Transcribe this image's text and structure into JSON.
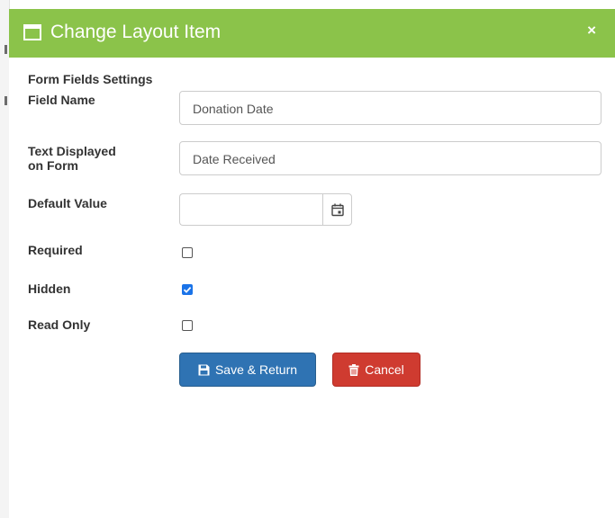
{
  "dialog": {
    "title": "Change Layout Item",
    "close_symbol": "×",
    "title_icon": "window-icon"
  },
  "form": {
    "section_title": "Form Fields Settings",
    "field_name": {
      "label": "Field Name",
      "value": "Donation Date"
    },
    "text_displayed": {
      "label_line1": "Text Displayed",
      "label_line2": "on Form",
      "value": "Date Received"
    },
    "default_value": {
      "label": "Default Value",
      "value": "",
      "icon": "calendar-icon"
    },
    "required": {
      "label": "Required",
      "checked": false
    },
    "hidden": {
      "label": "Hidden",
      "checked": true
    },
    "read_only": {
      "label": "Read Only",
      "checked": false
    }
  },
  "buttons": {
    "save_label": "Save & Return",
    "save_icon": "floppy-disk-icon",
    "cancel_label": "Cancel",
    "cancel_icon": "trash-icon"
  },
  "colors": {
    "title_bar": "#8bc34a",
    "save_button": "#2f73b3",
    "cancel_button": "#cf3b30",
    "checkbox_checked": "#1a73e8"
  }
}
